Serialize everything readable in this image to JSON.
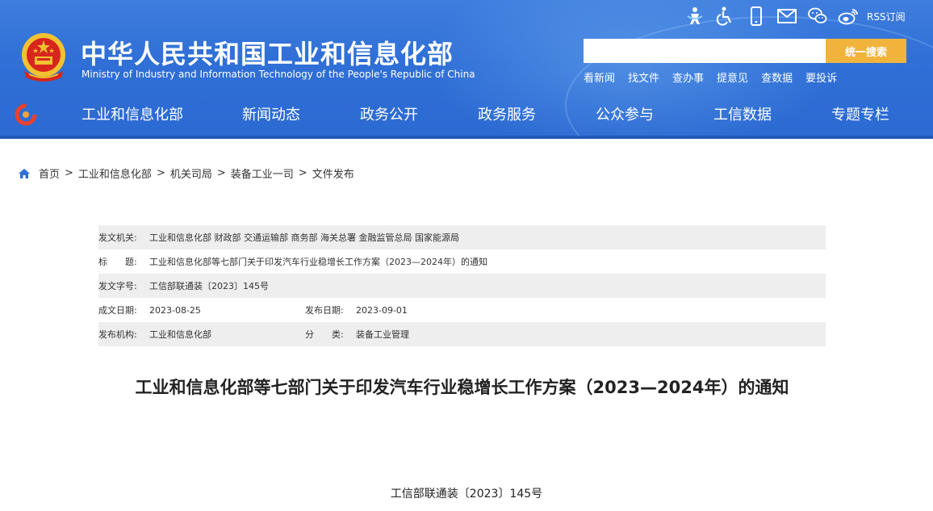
{
  "header": {
    "title_cn": "中华人民共和国工业和信息化部",
    "title_en": "Ministry of Industry and Information Technology of the People's Republic of China",
    "top_icons": [
      "elderly-mode-icon",
      "accessibility-icon",
      "mobile-icon",
      "mail-icon",
      "wechat-icon",
      "weibo-icon"
    ],
    "rss_label": "RSS订阅",
    "search": {
      "placeholder": "",
      "button_label": "统一搜索"
    },
    "quick_links": [
      "看新闻",
      "找文件",
      "查办事",
      "提意见",
      "查数据",
      "要投诉"
    ],
    "colors": {
      "header_bg": "#3070d8",
      "search_button": "#f0b43d"
    }
  },
  "nav": {
    "items": [
      "工业和信息化部",
      "新闻动态",
      "政务公开",
      "政务服务",
      "公众参与",
      "工信数据",
      "专题专栏"
    ]
  },
  "breadcrumb": {
    "items": [
      "首页",
      "工业和信息化部",
      "机关司局",
      "装备工业一司",
      "文件发布"
    ],
    "separator": ">"
  },
  "info": {
    "issuer_label": "发文机关:",
    "issuer_value": "工业和信息化部 财政部 交通运输部 商务部 海关总署 金融监管总局 国家能源局",
    "title_label": "标　　题:",
    "title_value": "工业和信息化部等七部门关于印发汽车行业稳增长工作方案（2023—2024年）的通知",
    "docno_label": "发文字号:",
    "docno_value": "工信部联通装〔2023〕145号",
    "created_label": "成文日期:",
    "created_value": "2023-08-25",
    "published_label": "发布日期:",
    "published_value": "2023-09-01",
    "org_label": "发布机构:",
    "org_value": "工业和信息化部",
    "category_label": "分　　类:",
    "category_value": "装备工业管理"
  },
  "article": {
    "title": "工业和信息化部等七部门关于印发汽车行业稳增长工作方案（2023—2024年）的通知",
    "doc_number": "工信部联通装〔2023〕145号"
  }
}
